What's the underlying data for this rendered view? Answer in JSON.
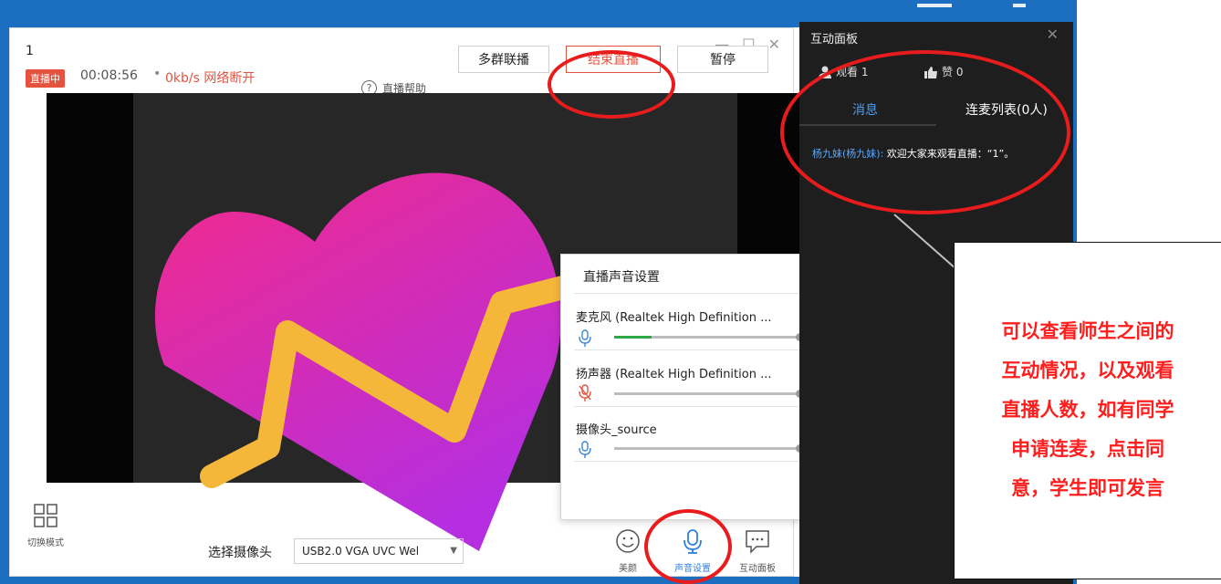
{
  "window": {
    "minimize_glyph": "—",
    "maximize_glyph": "☐",
    "close_glyph": "✕"
  },
  "room": {
    "number": "1"
  },
  "status": {
    "badge": "直播中",
    "timer": "00:08:56",
    "separator": "•",
    "network": "0kb/s 网络断开"
  },
  "header": {
    "help_label": "直播帮助",
    "help_icon": "question-circle-icon",
    "buttons": [
      {
        "label": "多群联播"
      },
      {
        "label": "结束直播",
        "accent": "#e5533f"
      },
      {
        "label": "暂停"
      }
    ]
  },
  "bottom_bar": {
    "switch_mode_label": "切换模式",
    "camera_label": "选择摄像头",
    "camera_value": "USB2.0 VGA UVC Wel",
    "tools": [
      {
        "label": "美颜",
        "icon": "smile-icon"
      },
      {
        "label": "声音设置",
        "icon": "microphone-icon",
        "active": true
      },
      {
        "label": "互动面板",
        "icon": "chat-bubble-icon"
      }
    ]
  },
  "sound_settings": {
    "title": "直播声音设置",
    "devices": [
      {
        "name": "麦克风 (Realtek High Definition ...",
        "icon": "microphone-icon",
        "level": 0.2,
        "icon_color": "#3a86d8"
      },
      {
        "name": "扬声器 (Realtek High Definition ...",
        "icon": "muted-microphone-icon",
        "level": 0,
        "icon_color": "#e5533f"
      },
      {
        "name": "摄像头_source",
        "icon": "microphone-icon",
        "level": 0,
        "icon_color": "#3a86d8"
      }
    ]
  },
  "panel": {
    "title": "互动面板",
    "close_glyph": "✕",
    "viewers_label": "观看 1",
    "likes_label": "赞 0",
    "tabs": [
      {
        "label": "消息"
      },
      {
        "label": "连麦列表(0人)"
      }
    ],
    "messages": [
      {
        "sender": "杨九妹(杨九妹):",
        "text": " 欢迎大家来观看直播：“1”。"
      }
    ]
  },
  "annotation": {
    "text_lines": [
      "可以查看师生之间的",
      "互动情况，以及观看",
      "直播人数，如有同学",
      "申请连麦，点击同",
      "意，学生即可发言"
    ],
    "color": "#ff1e1e"
  },
  "colors": {
    "accent": "#e5533f",
    "active_blue": "#2f7fe0",
    "desktop": "#1c6fc0",
    "panel_bg": "#1e1e1e",
    "ring": "#e81c1c"
  }
}
